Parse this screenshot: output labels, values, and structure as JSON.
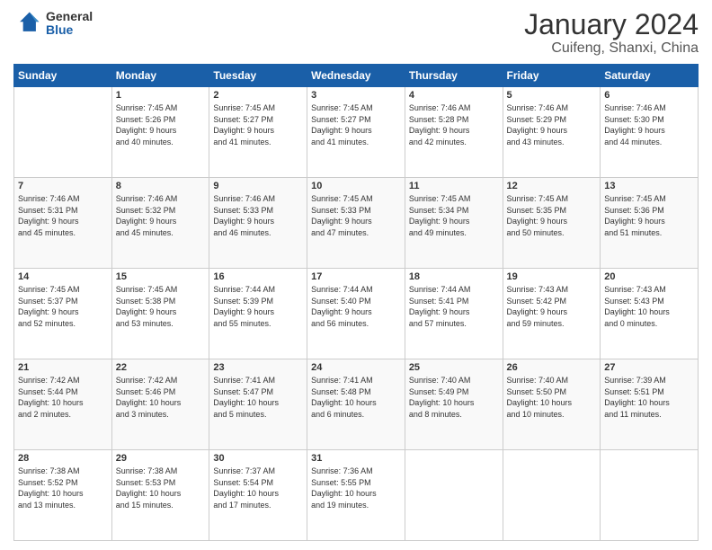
{
  "header": {
    "logo": {
      "general": "General",
      "blue": "Blue"
    },
    "title": "January 2024",
    "subtitle": "Cuifeng, Shanxi, China"
  },
  "calendar": {
    "days_of_week": [
      "Sunday",
      "Monday",
      "Tuesday",
      "Wednesday",
      "Thursday",
      "Friday",
      "Saturday"
    ],
    "weeks": [
      [
        {
          "day": "",
          "info": ""
        },
        {
          "day": "1",
          "info": "Sunrise: 7:45 AM\nSunset: 5:26 PM\nDaylight: 9 hours\nand 40 minutes."
        },
        {
          "day": "2",
          "info": "Sunrise: 7:45 AM\nSunset: 5:27 PM\nDaylight: 9 hours\nand 41 minutes."
        },
        {
          "day": "3",
          "info": "Sunrise: 7:45 AM\nSunset: 5:27 PM\nDaylight: 9 hours\nand 41 minutes."
        },
        {
          "day": "4",
          "info": "Sunrise: 7:46 AM\nSunset: 5:28 PM\nDaylight: 9 hours\nand 42 minutes."
        },
        {
          "day": "5",
          "info": "Sunrise: 7:46 AM\nSunset: 5:29 PM\nDaylight: 9 hours\nand 43 minutes."
        },
        {
          "day": "6",
          "info": "Sunrise: 7:46 AM\nSunset: 5:30 PM\nDaylight: 9 hours\nand 44 minutes."
        }
      ],
      [
        {
          "day": "7",
          "info": "Sunrise: 7:46 AM\nSunset: 5:31 PM\nDaylight: 9 hours\nand 45 minutes."
        },
        {
          "day": "8",
          "info": "Sunrise: 7:46 AM\nSunset: 5:32 PM\nDaylight: 9 hours\nand 45 minutes."
        },
        {
          "day": "9",
          "info": "Sunrise: 7:46 AM\nSunset: 5:33 PM\nDaylight: 9 hours\nand 46 minutes."
        },
        {
          "day": "10",
          "info": "Sunrise: 7:45 AM\nSunset: 5:33 PM\nDaylight: 9 hours\nand 47 minutes."
        },
        {
          "day": "11",
          "info": "Sunrise: 7:45 AM\nSunset: 5:34 PM\nDaylight: 9 hours\nand 49 minutes."
        },
        {
          "day": "12",
          "info": "Sunrise: 7:45 AM\nSunset: 5:35 PM\nDaylight: 9 hours\nand 50 minutes."
        },
        {
          "day": "13",
          "info": "Sunrise: 7:45 AM\nSunset: 5:36 PM\nDaylight: 9 hours\nand 51 minutes."
        }
      ],
      [
        {
          "day": "14",
          "info": "Sunrise: 7:45 AM\nSunset: 5:37 PM\nDaylight: 9 hours\nand 52 minutes."
        },
        {
          "day": "15",
          "info": "Sunrise: 7:45 AM\nSunset: 5:38 PM\nDaylight: 9 hours\nand 53 minutes."
        },
        {
          "day": "16",
          "info": "Sunrise: 7:44 AM\nSunset: 5:39 PM\nDaylight: 9 hours\nand 55 minutes."
        },
        {
          "day": "17",
          "info": "Sunrise: 7:44 AM\nSunset: 5:40 PM\nDaylight: 9 hours\nand 56 minutes."
        },
        {
          "day": "18",
          "info": "Sunrise: 7:44 AM\nSunset: 5:41 PM\nDaylight: 9 hours\nand 57 minutes."
        },
        {
          "day": "19",
          "info": "Sunrise: 7:43 AM\nSunset: 5:42 PM\nDaylight: 9 hours\nand 59 minutes."
        },
        {
          "day": "20",
          "info": "Sunrise: 7:43 AM\nSunset: 5:43 PM\nDaylight: 10 hours\nand 0 minutes."
        }
      ],
      [
        {
          "day": "21",
          "info": "Sunrise: 7:42 AM\nSunset: 5:44 PM\nDaylight: 10 hours\nand 2 minutes."
        },
        {
          "day": "22",
          "info": "Sunrise: 7:42 AM\nSunset: 5:46 PM\nDaylight: 10 hours\nand 3 minutes."
        },
        {
          "day": "23",
          "info": "Sunrise: 7:41 AM\nSunset: 5:47 PM\nDaylight: 10 hours\nand 5 minutes."
        },
        {
          "day": "24",
          "info": "Sunrise: 7:41 AM\nSunset: 5:48 PM\nDaylight: 10 hours\nand 6 minutes."
        },
        {
          "day": "25",
          "info": "Sunrise: 7:40 AM\nSunset: 5:49 PM\nDaylight: 10 hours\nand 8 minutes."
        },
        {
          "day": "26",
          "info": "Sunrise: 7:40 AM\nSunset: 5:50 PM\nDaylight: 10 hours\nand 10 minutes."
        },
        {
          "day": "27",
          "info": "Sunrise: 7:39 AM\nSunset: 5:51 PM\nDaylight: 10 hours\nand 11 minutes."
        }
      ],
      [
        {
          "day": "28",
          "info": "Sunrise: 7:38 AM\nSunset: 5:52 PM\nDaylight: 10 hours\nand 13 minutes."
        },
        {
          "day": "29",
          "info": "Sunrise: 7:38 AM\nSunset: 5:53 PM\nDaylight: 10 hours\nand 15 minutes."
        },
        {
          "day": "30",
          "info": "Sunrise: 7:37 AM\nSunset: 5:54 PM\nDaylight: 10 hours\nand 17 minutes."
        },
        {
          "day": "31",
          "info": "Sunrise: 7:36 AM\nSunset: 5:55 PM\nDaylight: 10 hours\nand 19 minutes."
        },
        {
          "day": "",
          "info": ""
        },
        {
          "day": "",
          "info": ""
        },
        {
          "day": "",
          "info": ""
        }
      ]
    ]
  }
}
